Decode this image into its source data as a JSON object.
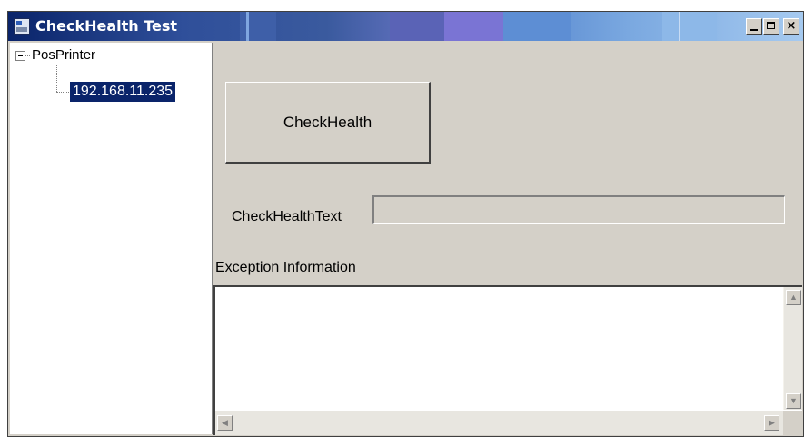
{
  "window": {
    "title": "CheckHealth Test",
    "minimize_symbol": "_",
    "maximize_symbol": "□",
    "close_symbol": "×",
    "title_color": "#ffffff",
    "titlebar_color": "#0a246a"
  },
  "tree": {
    "root_label": "PosPrinter",
    "root_expanded": true,
    "child_label": "192.168.11.235",
    "child_selected": true,
    "selection_color": "#0a246a"
  },
  "main": {
    "check_button_label": "CheckHealth",
    "check_health_text_label": "CheckHealthText",
    "check_health_text_value": "",
    "exception_label": "Exception Information",
    "exception_text": ""
  },
  "scrollbars": {
    "up_arrow": "▲",
    "down_arrow": "▼",
    "left_arrow": "◀",
    "right_arrow": "▶"
  },
  "icons": {
    "app": "app-window-icon",
    "tree_toggle": "collapse-minus-icon"
  }
}
